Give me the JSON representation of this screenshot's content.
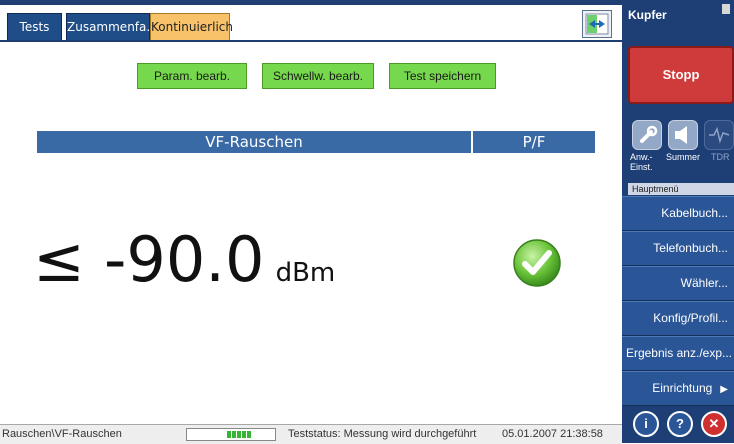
{
  "tabs": [
    "Tests",
    "Zusammenfa.",
    "Kontinuierlich"
  ],
  "actions": {
    "edit_params": "Param. bearb.",
    "edit_thresholds": "Schwellw. bearb.",
    "save_test": "Test speichern"
  },
  "table": {
    "col_measurement": "VF-Rauschen",
    "col_pf": "P/F"
  },
  "reading": {
    "symbol": "≤",
    "value": "-90.0",
    "unit": "dBm",
    "result": "pass"
  },
  "status": {
    "path": "Rauschen\\VF-Rauschen",
    "progress_segments": 5,
    "test_status": "Teststatus: Messung wird durchgeführt",
    "datetime": "05.01.2007 21:38:58"
  },
  "sidebar": {
    "title": "Kupfer",
    "stop_label": "Stopp",
    "tools": [
      {
        "label": "Anw.-\nEinst.",
        "icon": "wrench-icon"
      },
      {
        "label": "Summer",
        "icon": "speaker-icon"
      },
      {
        "label": "TDR",
        "icon": "waveform-icon"
      }
    ],
    "main_menu_label": "Hauptmenü",
    "menu": [
      "Kabelbuch...",
      "Telefonbuch...",
      "Wähler...",
      "Konfig/Profil...",
      "Ergebnis anz./exp...",
      "Einrichtung"
    ],
    "bottom_buttons": [
      "info",
      "help",
      "close"
    ]
  },
  "colors": {
    "accent": "#1f3f73",
    "button_green": "#76d84c",
    "stop_red": "#cf3a3a",
    "header_blue": "#3a6aa5",
    "pass_green": "#6bc43a"
  }
}
